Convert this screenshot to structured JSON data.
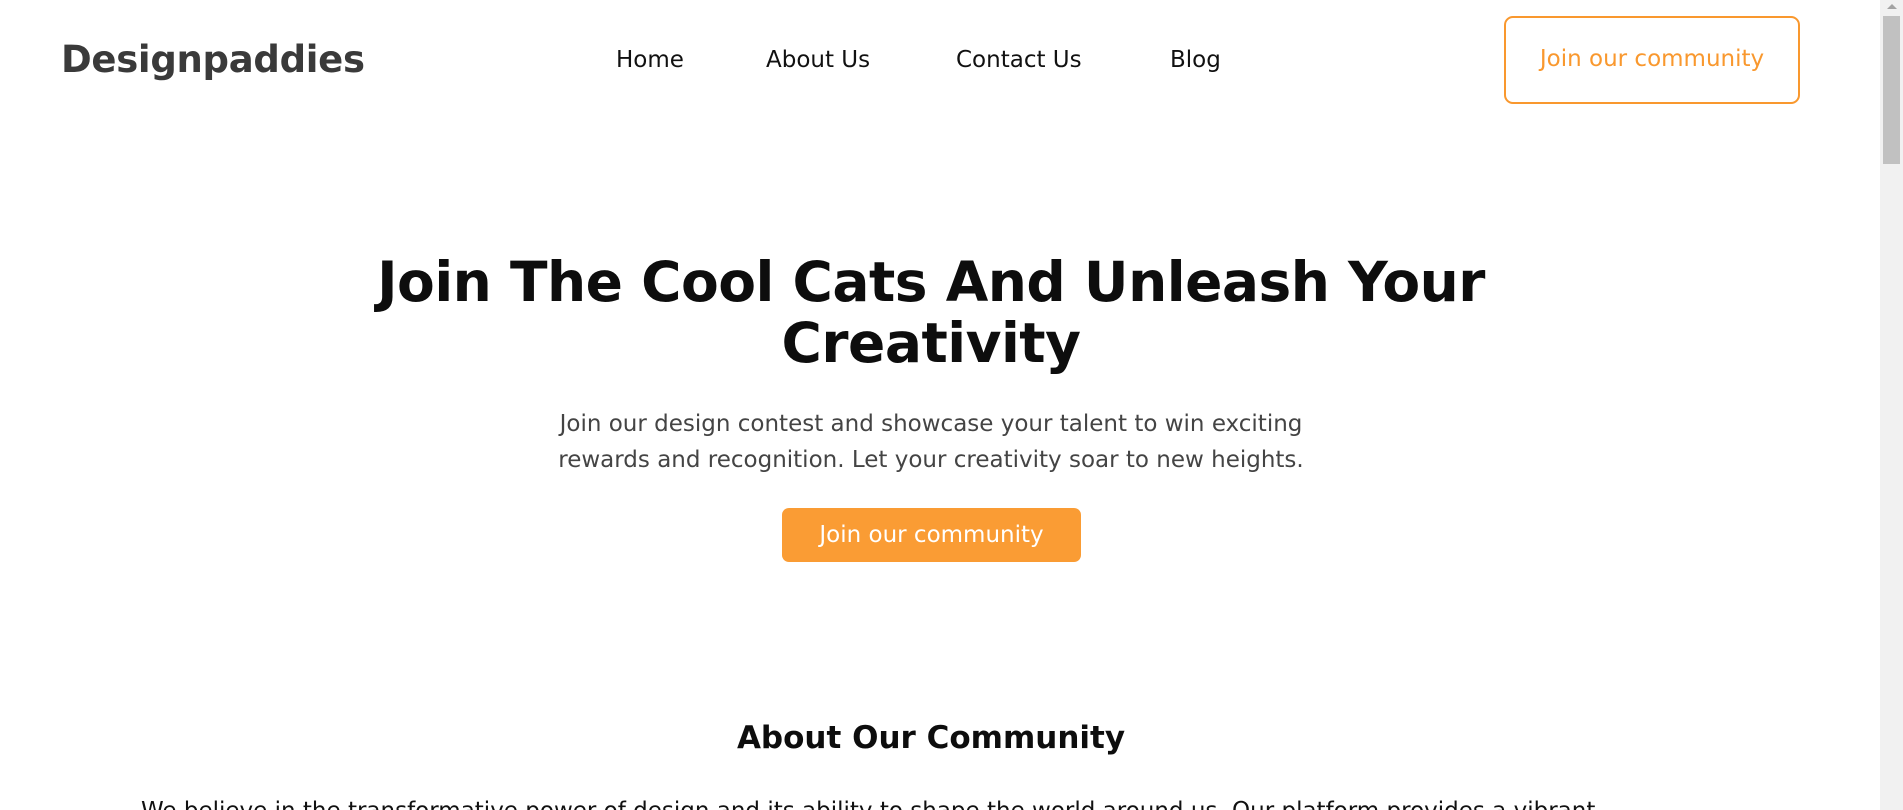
{
  "header": {
    "logo": "Designpaddies",
    "nav": {
      "home": "Home",
      "about": "About Us",
      "contact": "Contact Us",
      "blog": "Blog"
    },
    "cta_label": "Join our community"
  },
  "hero": {
    "title_line1": "Join The Cool Cats And Unleash Your",
    "title_line2": "Creativity",
    "subtitle_line1": "Join our design contest and showcase your talent to win exciting",
    "subtitle_line2": "rewards and recognition. Let your creativity soar to new heights.",
    "cta_label": "Join our community"
  },
  "about": {
    "title": "About Our Community",
    "text": "We believe in the transformative power of design and its ability to shape the world around us. Our platform provides a vibrant"
  },
  "colors": {
    "accent": "#f9982e",
    "accent_fill": "#fa9c34",
    "logo": "#3a3a3a",
    "text": "#111111",
    "muted": "#444444"
  }
}
